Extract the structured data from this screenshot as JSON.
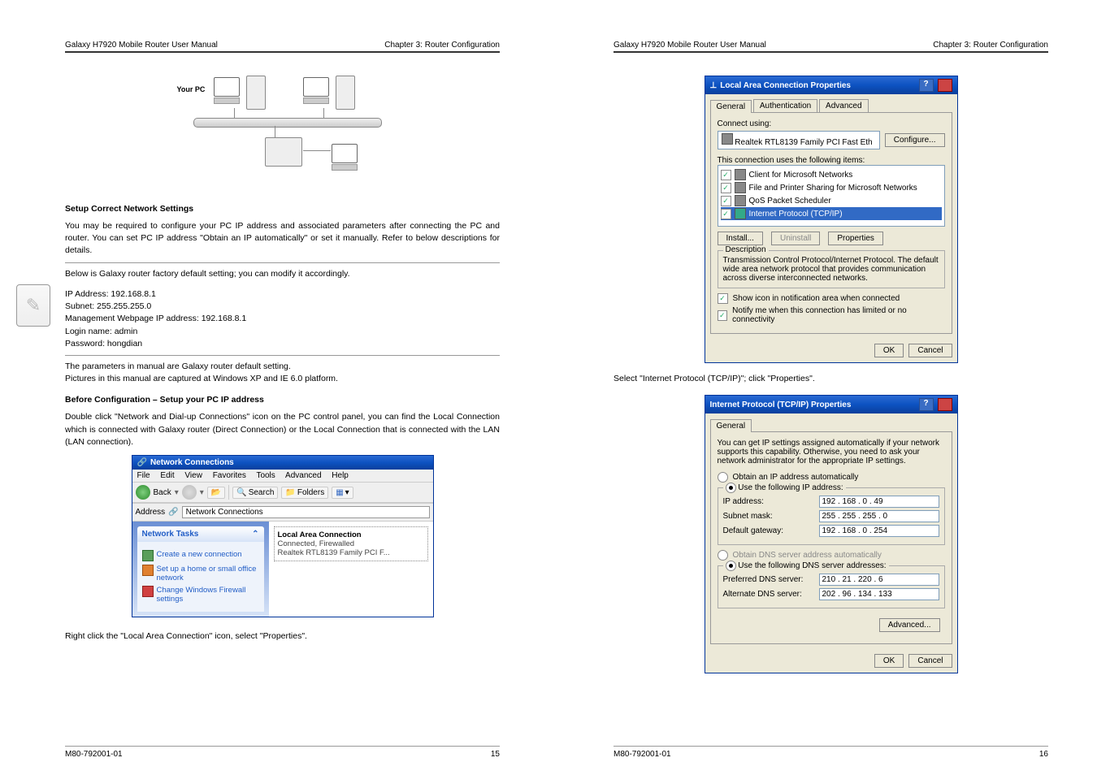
{
  "doc": {
    "header_left": "Galaxy H7920 Mobile Router User Manual",
    "header_right": "Chapter 3: Router Configuration",
    "footer_code": "M80-792001-01"
  },
  "pageL": {
    "diagram_label": "Your PC",
    "sect1_title": "Setup Correct Network Settings",
    "para1": "You may be required to configure your PC IP address and associated parameters after connecting the PC and router. You can set PC IP address \"Obtain an IP automatically\" or set it manually. Refer to below descriptions for details.",
    "para2": "Below is Galaxy router factory default setting; you can modify it accordingly.",
    "defaults": {
      "l1": "IP Address: 192.168.8.1",
      "l2": "Subnet: 255.255.255.0",
      "l3": "Management Webpage IP address: 192.168.8.1",
      "l4": "Login name: admin",
      "l5": "Password: hongdian"
    },
    "note1": "The parameters in manual are Galaxy router default setting.",
    "note2": "Pictures in this manual are captured at Windows XP and IE 6.0 platform.",
    "sect2_title": "Before Configuration – Setup your PC IP address",
    "para3": "Double click \"Network and Dial-up Connections\" icon on the PC control panel, you can find the Local Connection which is connected with Galaxy router (Direct Connection) or the Local Connection that is connected with the LAN (LAN connection).",
    "netconn": {
      "title": "Network Connections",
      "menu": [
        "File",
        "Edit",
        "View",
        "Favorites",
        "Tools",
        "Advanced",
        "Help"
      ],
      "back": "Back",
      "search": "Search",
      "folders": "Folders",
      "addr_label": "Address",
      "addr_value": "Network Connections",
      "tasks_hdr": "Network Tasks",
      "task1": "Create a new connection",
      "task2": "Set up a home or small office network",
      "task3": "Change Windows Firewall settings",
      "item_name": "Local Area Connection",
      "item_status": "Connected, Firewalled",
      "item_device": "Realtek RTL8139 Family PCI F..."
    },
    "para4": "Right click the \"Local Area Connection\" icon, select \"Properties\".",
    "page_no": "15"
  },
  "pageR": {
    "lac": {
      "title": "Local Area Connection Properties",
      "tabs": [
        "General",
        "Authentication",
        "Advanced"
      ],
      "connect_using_lbl": "Connect using:",
      "adapter": "Realtek RTL8139 Family PCI Fast Eth",
      "configure_btn": "Configure...",
      "items_lbl": "This connection uses the following items:",
      "items": [
        "Client for Microsoft Networks",
        "File and Printer Sharing for Microsoft Networks",
        "QoS Packet Scheduler",
        "Internet Protocol (TCP/IP)"
      ],
      "install": "Install...",
      "uninstall": "Uninstall",
      "properties": "Properties",
      "desc_lbl": "Description",
      "desc": "Transmission Control Protocol/Internet Protocol. The default wide area network protocol that provides communication across diverse interconnected networks.",
      "chk1": "Show icon in notification area when connected",
      "chk2": "Notify me when this connection has limited or no connectivity",
      "ok": "OK",
      "cancel": "Cancel"
    },
    "mid_text": "Select \"Internet Protocol (TCP/IP)\"; click \"Properties\".",
    "tcp": {
      "title": "Internet Protocol (TCP/IP) Properties",
      "tab": "General",
      "blurb": "You can get IP settings assigned automatically if your network supports this capability. Otherwise, you need to ask your network administrator for the appropriate IP settings.",
      "r1": "Obtain an IP address automatically",
      "r2": "Use the following IP address:",
      "ip_lbl": "IP address:",
      "ip": "192 . 168 .  0  .  49",
      "mask_lbl": "Subnet mask:",
      "mask": "255 . 255 . 255 .  0",
      "gw_lbl": "Default gateway:",
      "gw": "192 . 168 .  0  . 254",
      "r3": "Obtain DNS server address automatically",
      "r4": "Use the following DNS server addresses:",
      "dns1_lbl": "Preferred DNS server:",
      "dns1": "210 .  21 . 220 .  6",
      "dns2_lbl": "Alternate DNS server:",
      "dns2": "202 .  96 . 134 . 133",
      "advanced": "Advanced...",
      "ok": "OK",
      "cancel": "Cancel"
    },
    "page_no": "16"
  }
}
